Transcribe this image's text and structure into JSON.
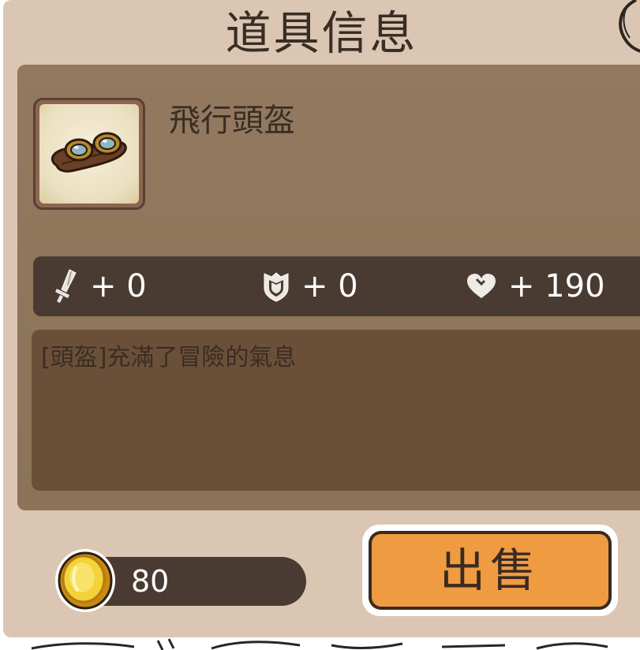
{
  "panel": {
    "title": "道具信息"
  },
  "item": {
    "name": "飛行頭盔",
    "icon": "goggles-icon",
    "description": "[頭盔]充滿了冒險的氣息"
  },
  "stats": {
    "attack": {
      "icon": "sword-icon",
      "value": "+ 0"
    },
    "defense": {
      "icon": "shield-icon",
      "value": "+ 0"
    },
    "health": {
      "icon": "heart-icon",
      "value": "+ 190"
    }
  },
  "price": {
    "icon": "gold-coin-icon",
    "value": "80"
  },
  "actions": {
    "sell_label": "出售"
  },
  "colors": {
    "panel_bg": "#dbc6b4",
    "content_bg": "#92795f",
    "stats_bg": "#4a3b32",
    "desc_bg": "#6b5039",
    "sell_button": "#ef9b42"
  }
}
